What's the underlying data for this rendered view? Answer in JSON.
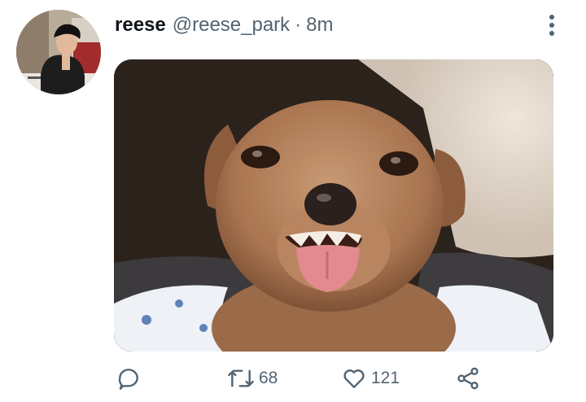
{
  "tweet": {
    "author_name": "reese",
    "handle": "@reese_park",
    "separator": "·",
    "time": "8m",
    "retweet_count": "68",
    "like_count": "121"
  },
  "icons": {
    "more": "more-vertical-icon",
    "reply": "reply-icon",
    "retweet": "retweet-icon",
    "like": "heart-icon",
    "share": "share-icon"
  },
  "colors": {
    "text_primary": "#0f1419",
    "text_secondary": "#536471",
    "background": "#ffffff"
  }
}
